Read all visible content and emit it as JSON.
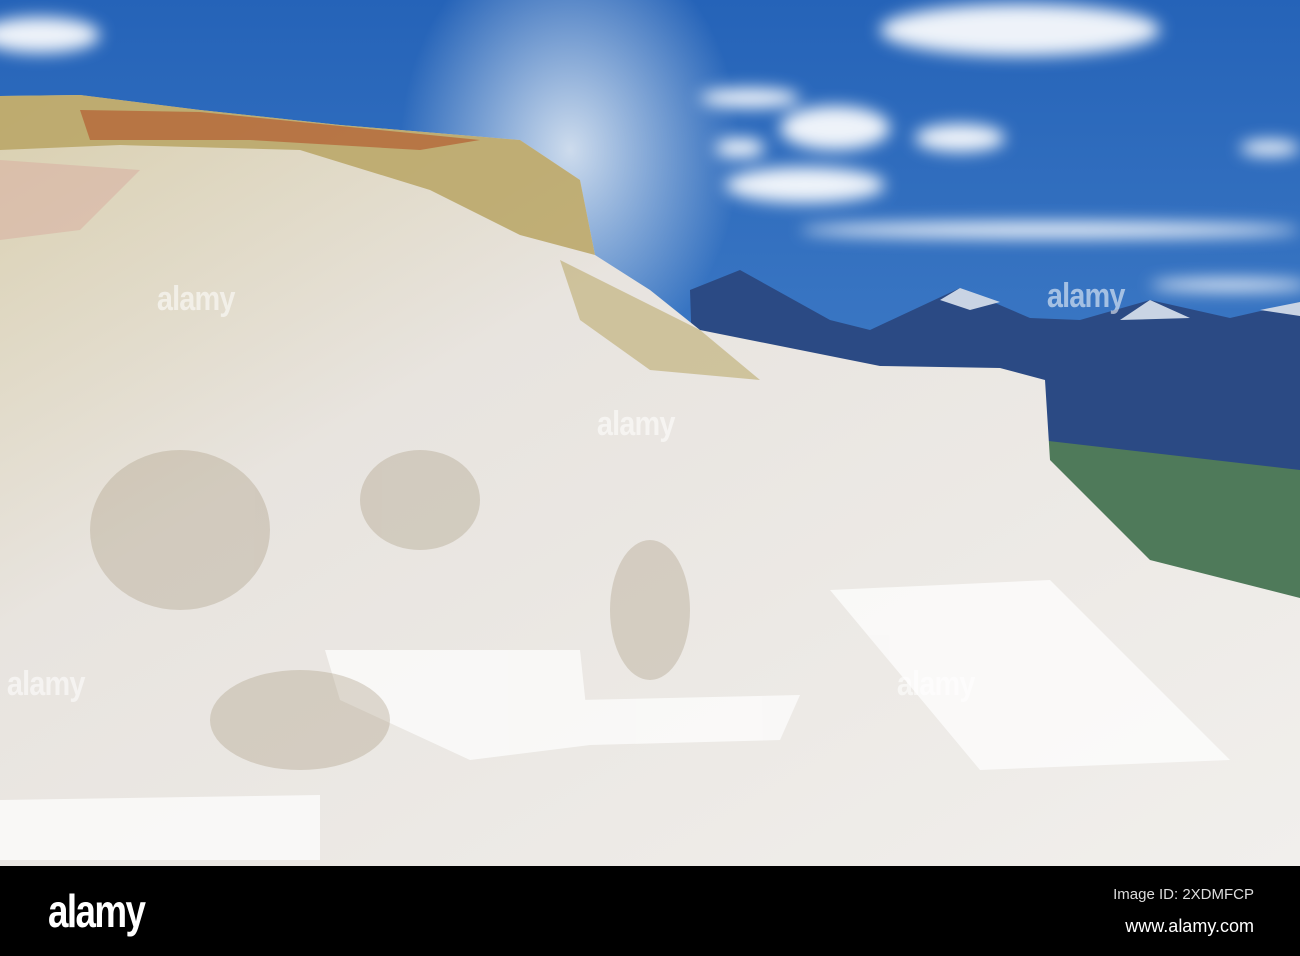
{
  "photo": {
    "subject": "travertine terraces",
    "colors": {
      "sky_top": "#2563b8",
      "sky_bottom": "#5a94d4",
      "mountain": "#2b4a84",
      "valley": "#4f7a5a",
      "terrace": "#e9e6e0",
      "mineral_orange": "#b5683a",
      "mineral_yellow": "#b8a564"
    }
  },
  "watermark": {
    "text": "alamy"
  },
  "footer": {
    "logo": "alamy",
    "image_id": "Image ID: 2XDMFCP",
    "website": "www.alamy.com"
  }
}
